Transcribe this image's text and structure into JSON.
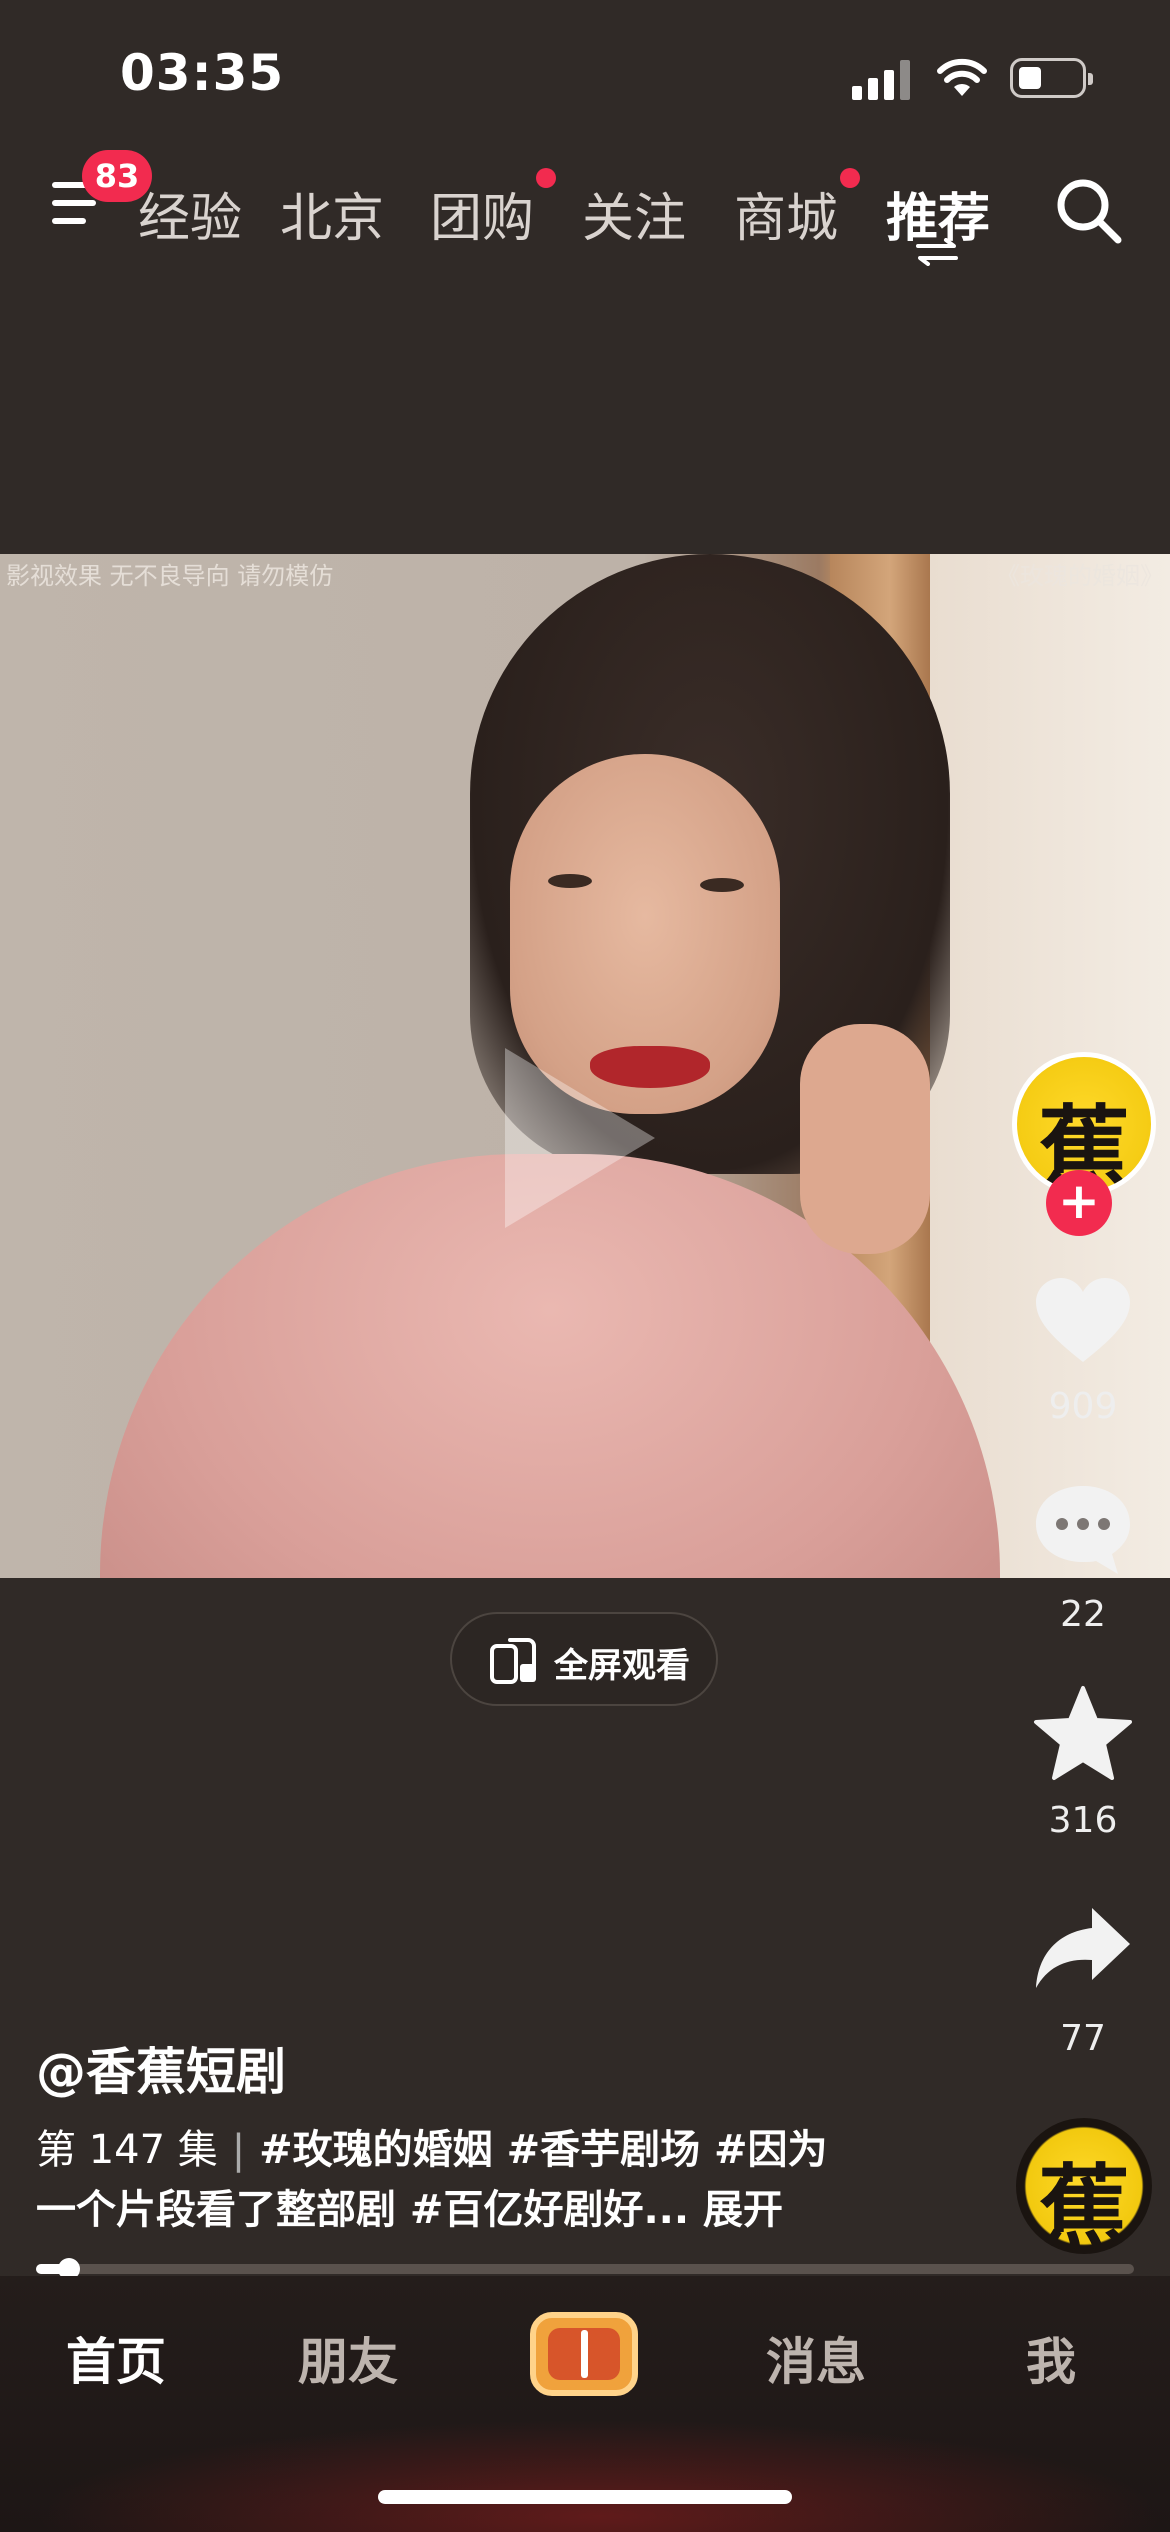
{
  "status_bar": {
    "time": "03:35"
  },
  "top_nav": {
    "menu_badge": "83",
    "tabs": [
      {
        "label": "经验",
        "dot": false
      },
      {
        "label": "北京",
        "dot": false
      },
      {
        "label": "团购",
        "dot": true
      },
      {
        "label": "关注",
        "dot": false
      },
      {
        "label": "商城",
        "dot": true
      },
      {
        "label": "推荐",
        "active": true
      }
    ]
  },
  "video": {
    "disclaimer": "影视效果 无不良导向 请勿模仿",
    "watermark": "《玫瑰的婚姻》",
    "fullscreen_label": "全屏观看"
  },
  "rail": {
    "avatar_glyph": "蕉",
    "like_count": "909",
    "comment_count": "22",
    "favorite_count": "316",
    "share_count": "77",
    "music_glyph": "蕉"
  },
  "post": {
    "author": "@香蕉短剧",
    "episode": "第 147 集",
    "separator": "|",
    "caption_line1": "#玫瑰的婚姻 #香芋剧场 #因为",
    "caption_line2": "一个片段看了整部剧 #百亿好剧好...",
    "expand": "展开"
  },
  "progress": {
    "played_fraction": 0.03
  },
  "bottom_tabs": {
    "home": "首页",
    "friends": "朋友",
    "messages": "消息",
    "me": "我"
  },
  "colors": {
    "accent_red": "#f22b4f",
    "background": "#302a27",
    "create_orange": "#f0a23c"
  }
}
